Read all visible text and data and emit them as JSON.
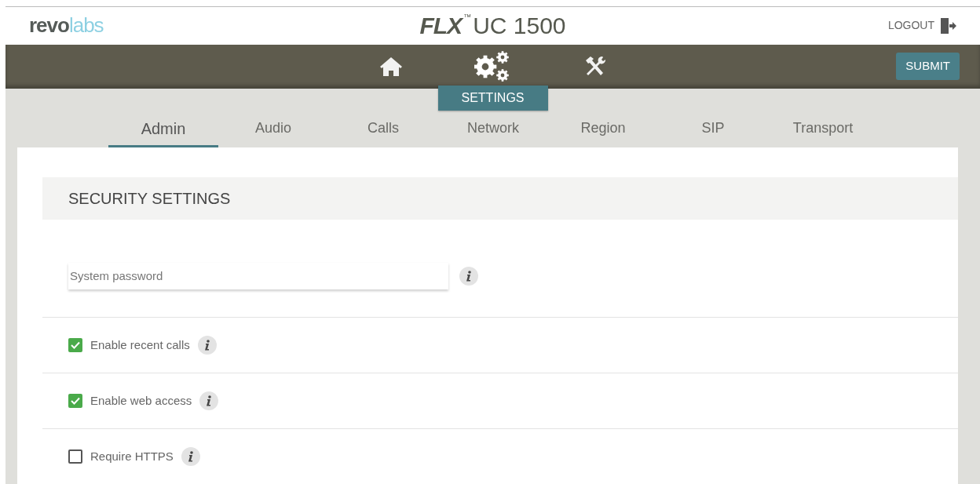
{
  "header": {
    "logo": {
      "dark": "revo",
      "light": "labs"
    },
    "product": {
      "brand": "FLX",
      "mark": "™",
      "model": "UC 1500"
    },
    "logout": "LOGOUT"
  },
  "nav": [
    {
      "kind": "home",
      "selected": false
    },
    {
      "kind": "settings",
      "selected": true,
      "label": "SETTINGS"
    },
    {
      "kind": "tools",
      "selected": false
    }
  ],
  "submit": "SUBMIT",
  "tabs": [
    {
      "label": "Admin",
      "selected": true
    },
    {
      "label": "Audio",
      "selected": false
    },
    {
      "label": "Calls",
      "selected": false
    },
    {
      "label": "Network",
      "selected": false
    },
    {
      "label": "Region",
      "selected": false
    },
    {
      "label": "SIP",
      "selected": false
    },
    {
      "label": "Transport",
      "selected": false
    }
  ],
  "section": {
    "title": "SECURITY SETTINGS"
  },
  "password": {
    "placeholder": "System password"
  },
  "options": [
    {
      "label": "Enable recent calls",
      "checked": true
    },
    {
      "label": "Enable web access",
      "checked": true
    },
    {
      "label": "Require HTTPS",
      "checked": false
    }
  ]
}
